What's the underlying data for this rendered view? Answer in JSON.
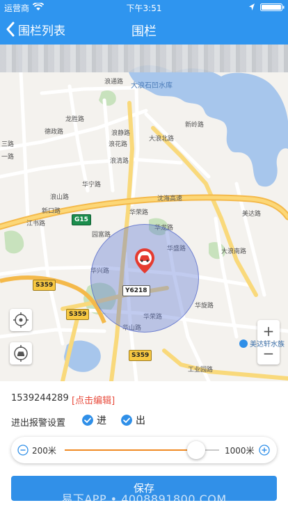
{
  "status_bar": {
    "carrier": "运营商",
    "time": "下午3:51"
  },
  "nav": {
    "back_label": "围栏列表",
    "title": "围栏"
  },
  "map": {
    "labels": {
      "reservoir": "大浪石凹水库",
      "langtong": "浪通路",
      "desheng": "德政路",
      "longsheng": "龙胜路",
      "langjing": "浪静路",
      "langhua": "浪花路",
      "langqing": "浪清路",
      "huaning": "华宁路",
      "hurong": "华荣路",
      "hulong": "华龙路",
      "huaxing": "华兴路",
      "huasheng": "华盛路",
      "huaxuan": "华旋路",
      "dalangbei": "大浪北路",
      "xinling": "新岭路",
      "yiwang": "一路",
      "sanlu": "三路",
      "langshan": "浪山路",
      "xinkou": "新口路",
      "jiangshu": "江书路",
      "yuanfu": "园富路",
      "hushan": "华山路",
      "dalangnan": "大浪南路",
      "meidi": "美达路",
      "expressway": "沈海高速",
      "huarong2": "华荣路",
      "gongye": "工业园路",
      "poi_meida": "美达轩水族"
    },
    "shields": {
      "g15": "G15",
      "s359a": "S359",
      "s359b": "S359",
      "s359c": "S359",
      "y6218": "Y6218"
    }
  },
  "panel": {
    "fence_id": "1539244289",
    "edit_label": "[点击编辑]",
    "alarm_label": "进出报警设置",
    "check_in": {
      "label": "进",
      "checked": true
    },
    "check_out": {
      "label": "出",
      "checked": true
    },
    "slider": {
      "min_label": "200米",
      "max_label": "1000米",
      "min": 200,
      "max": 1000,
      "value": 880
    },
    "save_label": "保存"
  },
  "watermark": "易下APP • 4008891800.COM",
  "colors": {
    "brand": "#2f95ef",
    "accent": "#f08a22",
    "warning": "#e84b3c"
  }
}
